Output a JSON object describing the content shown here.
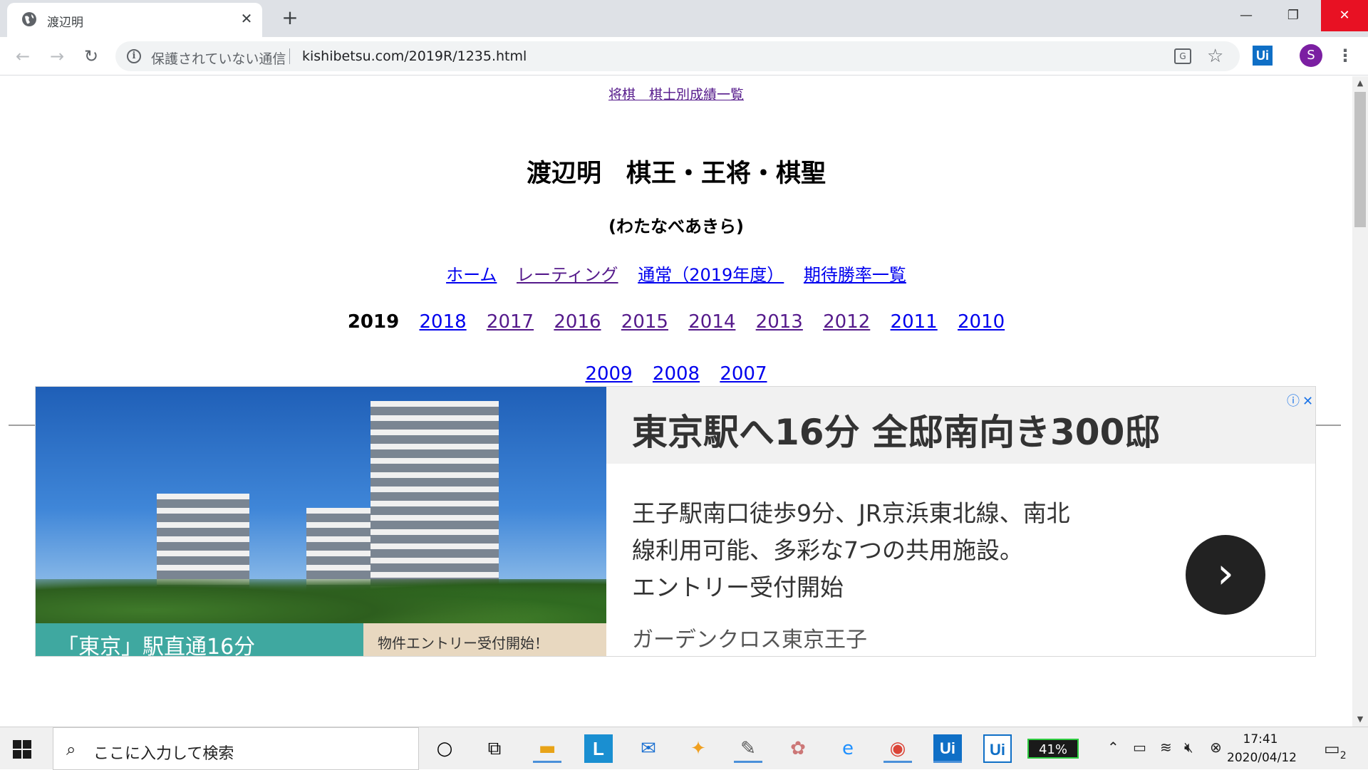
{
  "browser": {
    "tab_title": "渡辺明",
    "tab_close": "✕",
    "new_tab": "+",
    "security_text": "保護されていない通信",
    "url": "kishibetsu.com/2019R/1235.html",
    "profile_initial": "S",
    "extension_label": "Ui",
    "window_min": "—",
    "window_max": "❐",
    "window_close": "✕"
  },
  "page": {
    "top_link": "将棋　棋士別成績一覧",
    "heading": "渡辺明　棋王・王将・棋聖",
    "reading": "(わたなべあきら)",
    "nav_links": [
      "ホーム",
      "レーティング",
      "通常（2019年度）",
      "期待勝率一覧"
    ],
    "current_year": "2019",
    "year_links_row1": [
      "2018",
      "2017",
      "2016",
      "2015",
      "2014",
      "2013",
      "2012",
      "2011",
      "2010"
    ],
    "year_links_row2": [
      "2009",
      "2008",
      "2007"
    ]
  },
  "ad": {
    "headline": "東京駅へ16分 全邸南向き300邸",
    "body_line1": "王子駅南口徒歩9分、JR京浜東北線、南北",
    "body_line2": "線利用可能、多彩な7つの共用施設。",
    "body_line3": "エントリー受付開始",
    "brand": "ガーデンクロス東京王子",
    "banner_left": "「東京」駅直通16分",
    "banner_right": "物件エントリー受付開始！",
    "arrow": "›"
  },
  "taskbar": {
    "search_placeholder": "ここに入力して検索",
    "battery": "41%",
    "time": "17:41",
    "date": "2020/04/12",
    "notification_count": "2"
  },
  "colors": {
    "link_visited": "#551a8b",
    "link": "#0000ee",
    "close_red": "#e81123",
    "profile_purple": "#7b1fa2"
  }
}
